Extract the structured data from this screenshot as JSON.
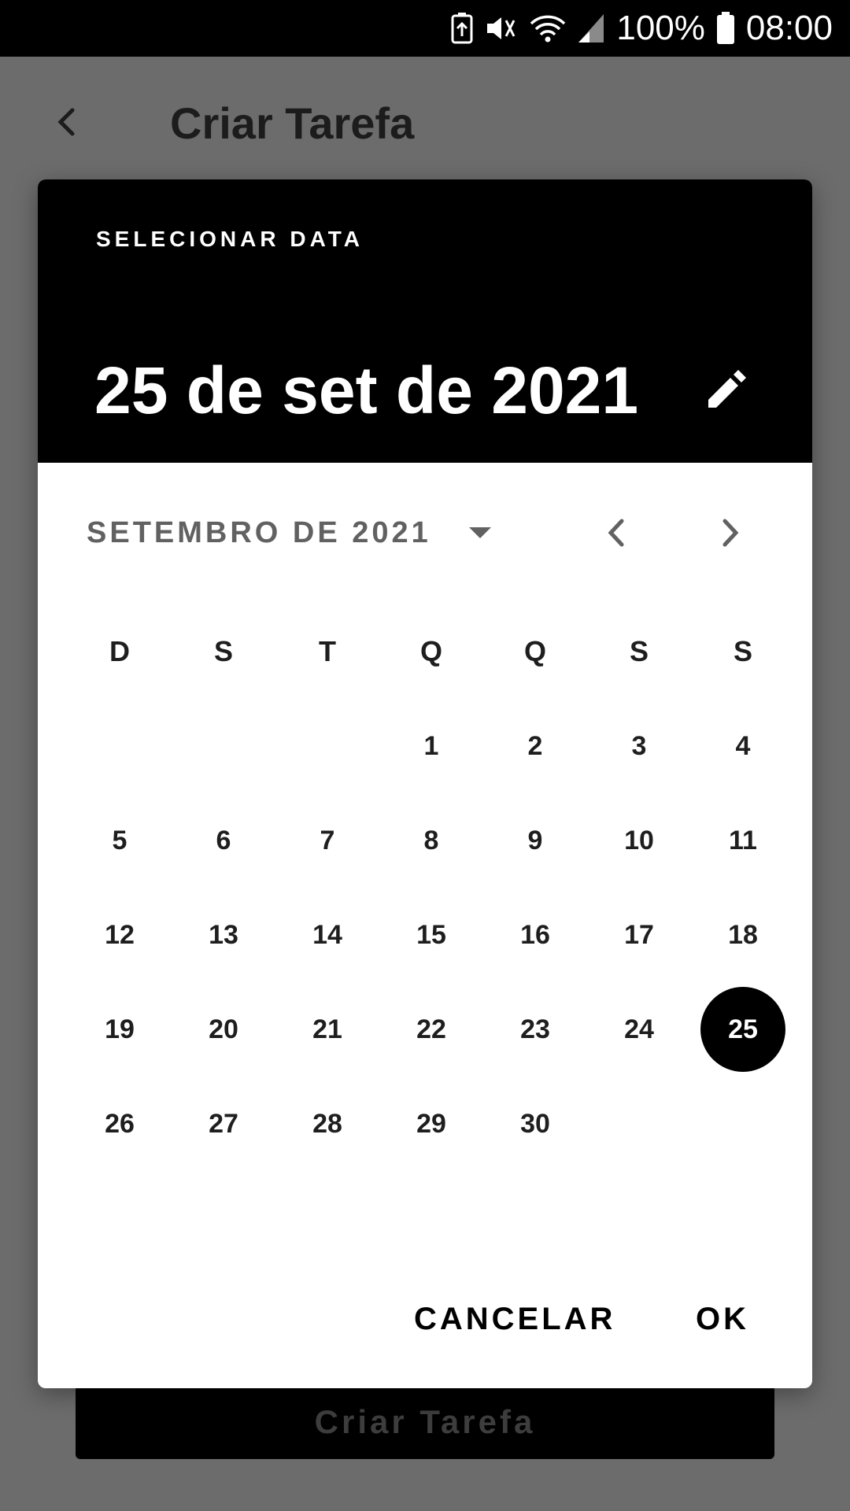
{
  "statusbar": {
    "battery_percent": "100%",
    "time": "08:00"
  },
  "app": {
    "title": "Criar Tarefa",
    "submit_label": "Criar Tarefa"
  },
  "dialog": {
    "label": "SELECIONAR DATA",
    "selected_date": "25 de set de 2021",
    "month_label": "SETEMBRO DE 2021",
    "weekdays": [
      "D",
      "S",
      "T",
      "Q",
      "Q",
      "S",
      "S"
    ],
    "weeks": [
      [
        "",
        "",
        "",
        "1",
        "2",
        "3",
        "4"
      ],
      [
        "5",
        "6",
        "7",
        "8",
        "9",
        "10",
        "11"
      ],
      [
        "12",
        "13",
        "14",
        "15",
        "16",
        "17",
        "18"
      ],
      [
        "19",
        "20",
        "21",
        "22",
        "23",
        "24",
        "25"
      ],
      [
        "26",
        "27",
        "28",
        "29",
        "30",
        "",
        ""
      ]
    ],
    "selected_day": "25",
    "cancel_label": "CANCELAR",
    "ok_label": "OK"
  },
  "colors": {
    "scrim": "#6c6c6c",
    "header": "#000000",
    "selected": "#000000"
  }
}
